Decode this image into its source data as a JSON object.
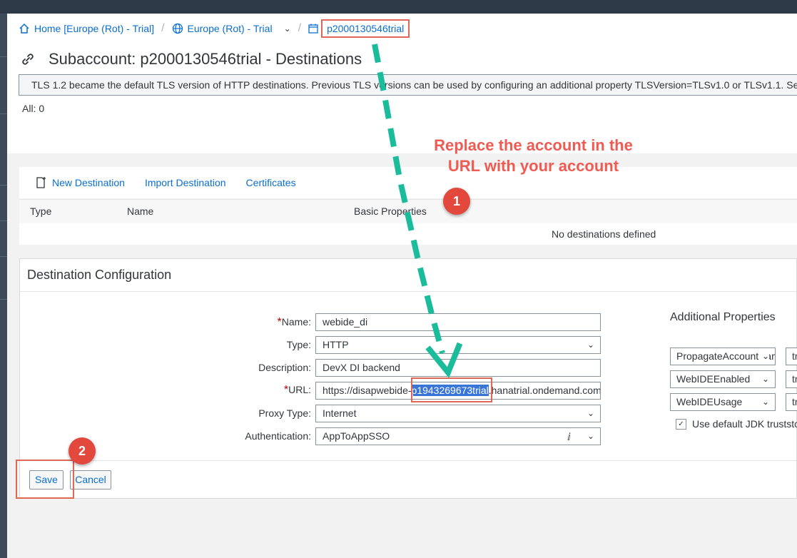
{
  "breadcrumb": {
    "home": "Home [Europe (Rot) - Trial]",
    "region": "Europe (Rot) - Trial",
    "current": "p2000130546trial"
  },
  "page_title": "Subaccount: p2000130546trial - Destinations",
  "info_message": "TLS 1.2 became the default TLS version of HTTP destinations. Previous TLS versions can be used by configuring an additional property TLSVersion=TLSv1.0 or TLSv1.1. Se",
  "all_count": "All: 0",
  "toolbar": {
    "new_destination": "New Destination",
    "import_destination": "Import Destination",
    "certificates": "Certificates"
  },
  "table": {
    "columns": [
      "Type",
      "Name",
      "Basic Properties"
    ],
    "empty_text": "No destinations defined"
  },
  "config": {
    "title": "Destination Configuration",
    "required_mark": "*",
    "name_label": "Name:",
    "name_value": "webide_di",
    "type_label": "Type:",
    "type_value": "HTTP",
    "description_label": "Description:",
    "description_value": "DevX DI backend",
    "url_label": "URL:",
    "url_prefix": "https://disapwebide-",
    "url_selected": "p1943269673trial",
    "url_suffix": ".hanatrial.ondemand.com",
    "proxy_label": "Proxy Type:",
    "proxy_value": "Internet",
    "auth_label": "Authentication:",
    "auth_value": "AppToAppSSO"
  },
  "additional": {
    "title": "Additional Properties",
    "properties": [
      {
        "key": "PropagateAccountName",
        "value": "true"
      },
      {
        "key": "WebIDEEnabled",
        "value": "true"
      },
      {
        "key": "WebIDEUsage",
        "value": "true"
      }
    ],
    "jdk_truststore": "Use default JDK truststore"
  },
  "buttons": {
    "save": "Save",
    "cancel": "Cancel"
  },
  "annotation": {
    "line1": "Replace the account in the",
    "line2": "URL with your account",
    "badge1": "1",
    "badge2": "2"
  },
  "colors": {
    "link": "#0a6ed1",
    "annotation": "#ef5b52",
    "arrow": "#1abc9c",
    "selection": "#3875d7"
  }
}
